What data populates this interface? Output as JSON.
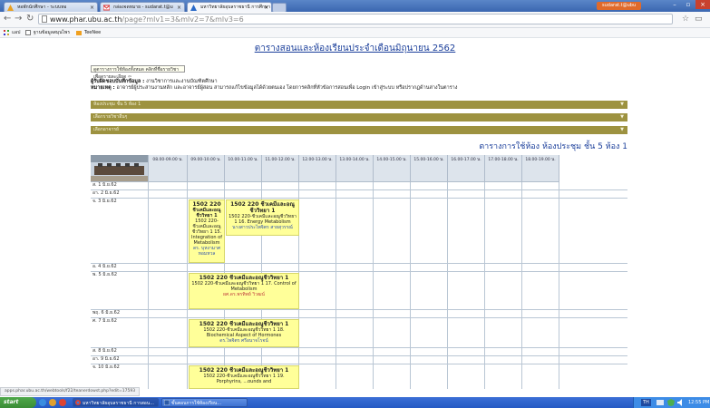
{
  "browser": {
    "tabs": [
      {
        "label": "หอพักนักศึกษา - ระบบหอ",
        "active": false
      },
      {
        "label": "กล่องจดหมาย - sudarat.t@u",
        "active": false
      },
      {
        "label": "มหาวิทยาลัยอุบลราชธานี การศึกษา",
        "active": true
      }
    ],
    "user_badge": "sudarat.t@ubu",
    "url_host": "www.phar.ubu.ac.th",
    "url_path": "/page?mlv1=3&mlv2=7&mlv3=6",
    "bookmarks": [
      {
        "label": "แอป",
        "icon": "apps-grid-icon"
      },
      {
        "label": "ฐานข้อมูลสมุนไพร",
        "icon": "page-icon"
      },
      {
        "label": "TeeNee",
        "icon": "folder-icon"
      }
    ]
  },
  "page": {
    "title": "ตารางสอนและห้องเรียนประจำเดือนมิถุนายน 2562",
    "legend_link": "ดูตารางการใช้ห้องทั้งหมด คลิกที่ชื่อรายวิชาเพื่อดูรายละเอียด ⇦",
    "note_line1_bold": "ผู้รับผิดชอบบันทึกข้อมูล :",
    "note_line1": " งานวิชาการและงานบัณฑิตศึกษา",
    "note_line2_bold": "หมายเหตุ :",
    "note_line2": " อาจารย์ผู้ประสานงานหลัก และอาจารย์ผู้สอน สามารถแก้ไขข้อมูลได้ด้วยตนเอง โดยการคลิกที่หัวข้อการสอนเพื่อ Login เข้าสู่ระบบ หรือปรากฏด้านล่างในตาราง",
    "bars": [
      "ห้องประชุม ชั้น 5 ห้อง 1",
      "เลือกรายวิชาอื่นๆ",
      "เลือกอาจารย์"
    ],
    "room_title": "ตารางการใช้ห้อง ห้องประชุม ชั้น 5 ห้อง 1"
  },
  "schedule": {
    "time_headers": [
      "08.00-09.00 น.",
      "09.00-10.00 น.",
      "10.00-11.00 น.",
      "11.00-12.00 น.",
      "12.00-13.00 น.",
      "13.00-14.00 น.",
      "14.00-15.00 น.",
      "15.00-16.00 น.",
      "16.00-17.00 น.",
      "17.00-18.00 น.",
      "18.00-19.00 น."
    ],
    "dates": [
      "ส. 1 มิ.ย.62",
      "อา. 2 มิ.ย.62",
      "จ. 3 มิ.ย.62",
      "อ. 4 มิ.ย.62",
      "พ. 5 มิ.ย.62",
      "พฤ. 6 มิ.ย.62",
      "ศ. 7 มิ.ย.62",
      "ส. 8 มิ.ย.62",
      "อา. 9 มิ.ย.62",
      "จ. 10 มิ.ย.62"
    ],
    "bookings": [
      {
        "code": "1502 220",
        "subject": "ชีวเคมีและอณูชีววิทยา 1",
        "detail": "1502 220-ชีวเคมีและอณูชีววิทยา 1 15. Integration of Metabolism",
        "instructor": "ดร. บุหงามาศ หอมหวล"
      },
      {
        "code": "1502 220 ชีวเคมีและอณูชีววิทยา 1",
        "subject": "",
        "detail": "1502 220-ชีวเคมีและอณูชีววิทยา 1 16. Energy Metabolism",
        "instructor": "นางสาวประไพจิตร สายสุวรรณ์"
      },
      {
        "code": "1502 220 ชีวเคมีและอณูชีววิทยา 1",
        "subject": "",
        "detail": "1502 220-ชีวเคมีและอณูชีววิทยา 1 17. Control of Metabolism",
        "instructor": "ผศ.ดร.พรทิพย์ วิวฒน์"
      },
      {
        "code": "1502 220 ชีวเคมีและอณูชีววิทยา 1",
        "subject": "",
        "detail": "1502 220-ชีวเคมีและอณูชีววิทยา 1 18. Biochemical Aspect of Hormones",
        "instructor": "ดร.ไพจิตร ศรีอนาจโรจน์"
      },
      {
        "code": "1502 220 ชีวเคมีและอณูชีววิทยา 1",
        "subject": "",
        "detail": "1502 220-ชีวเคมีและอณูชีววิทยา 1 19. Porphyrins, ...ounds and",
        "instructor": ""
      }
    ]
  },
  "status_url": "apps.phar.ubu.ac.th/webtools/f22/teanerdowst.php?edit=17593",
  "taskbar": {
    "start": "start",
    "items": [
      "มหาวิทยาลัยอุบลราชธานี การสอน...",
      "ขั้นตอนการใช้ห้องเรียน..."
    ],
    "lang": "TH",
    "clock": "12:55 PM"
  },
  "colors": {
    "bar": "#9d9240",
    "booking": "#ffff99",
    "title": "#1a3e9a"
  }
}
